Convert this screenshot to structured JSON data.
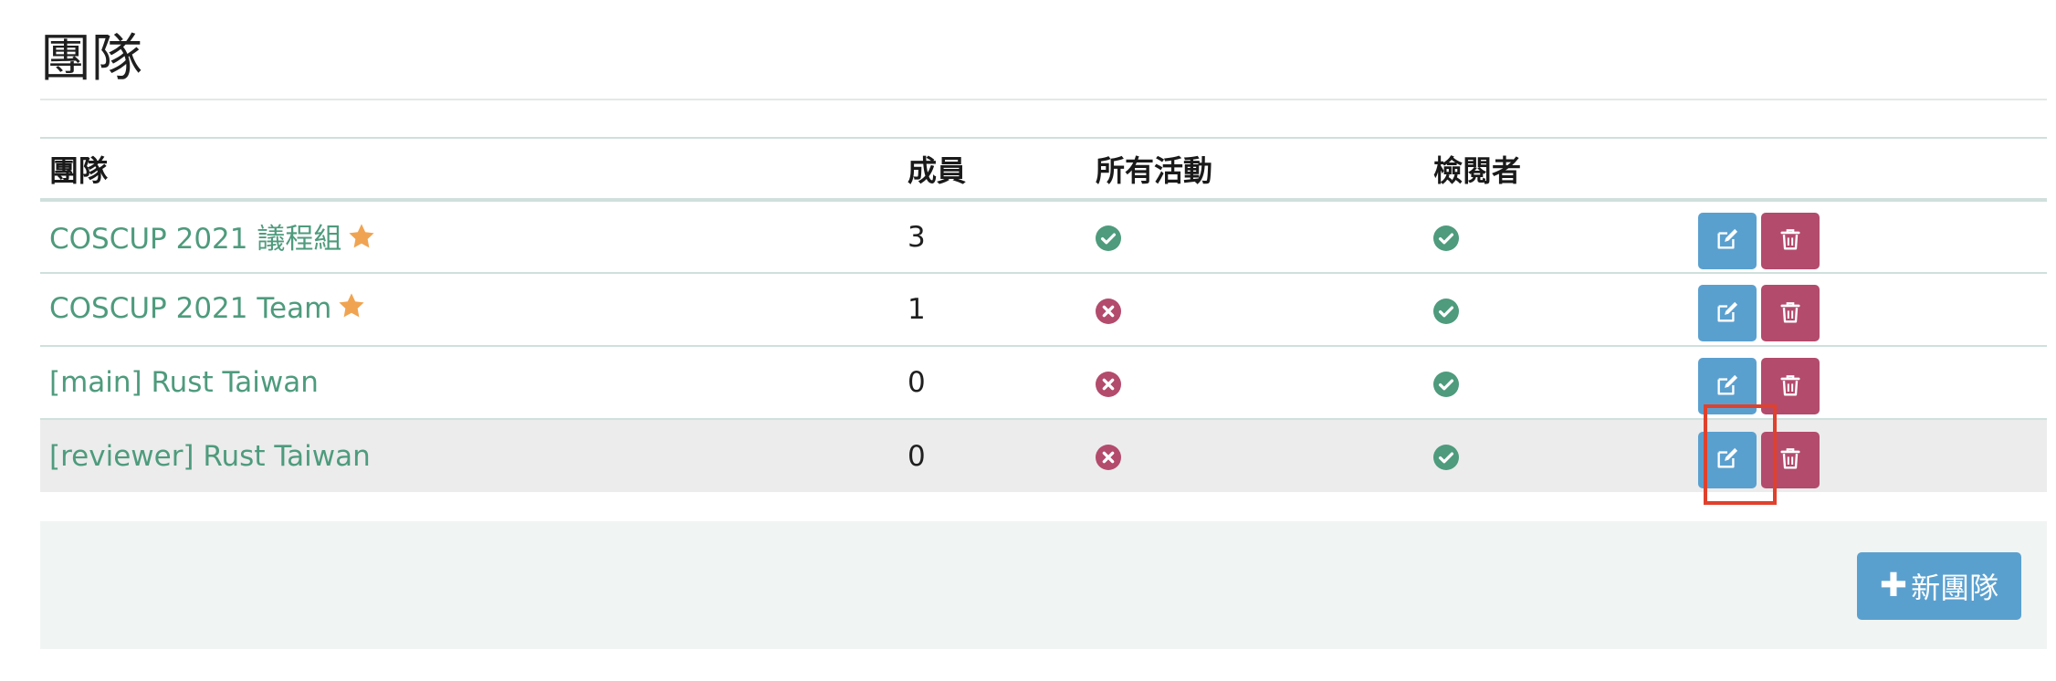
{
  "page": {
    "title": "團隊"
  },
  "table": {
    "headers": {
      "team": "團隊",
      "members": "成員",
      "all_events": "所有活動",
      "reviewer": "檢閱者"
    },
    "rows": [
      {
        "name": "COSCUP 2021 議程組",
        "starred": true,
        "members": "3",
        "all_events": true,
        "reviewer": true
      },
      {
        "name": "COSCUP 2021 Team",
        "starred": true,
        "members": "1",
        "all_events": false,
        "reviewer": true
      },
      {
        "name": "[main] Rust Taiwan",
        "starred": false,
        "members": "0",
        "all_events": false,
        "reviewer": true
      },
      {
        "name": "[reviewer] Rust Taiwan",
        "starred": false,
        "members": "0",
        "all_events": false,
        "reviewer": true
      }
    ]
  },
  "footer": {
    "new_team_label": "新團隊",
    "new_team_icon": "plus-icon"
  },
  "icons": {
    "edit": "edit-icon",
    "delete": "trash-icon",
    "yes": "check-circle-icon",
    "no": "x-circle-icon",
    "star": "star-icon"
  },
  "colors": {
    "link": "#4e9b7d",
    "success": "#4e9b7d",
    "danger": "#b34b6d",
    "primary": "#5aa0cf",
    "star": "#f0a451",
    "highlight": "#e0412c"
  }
}
